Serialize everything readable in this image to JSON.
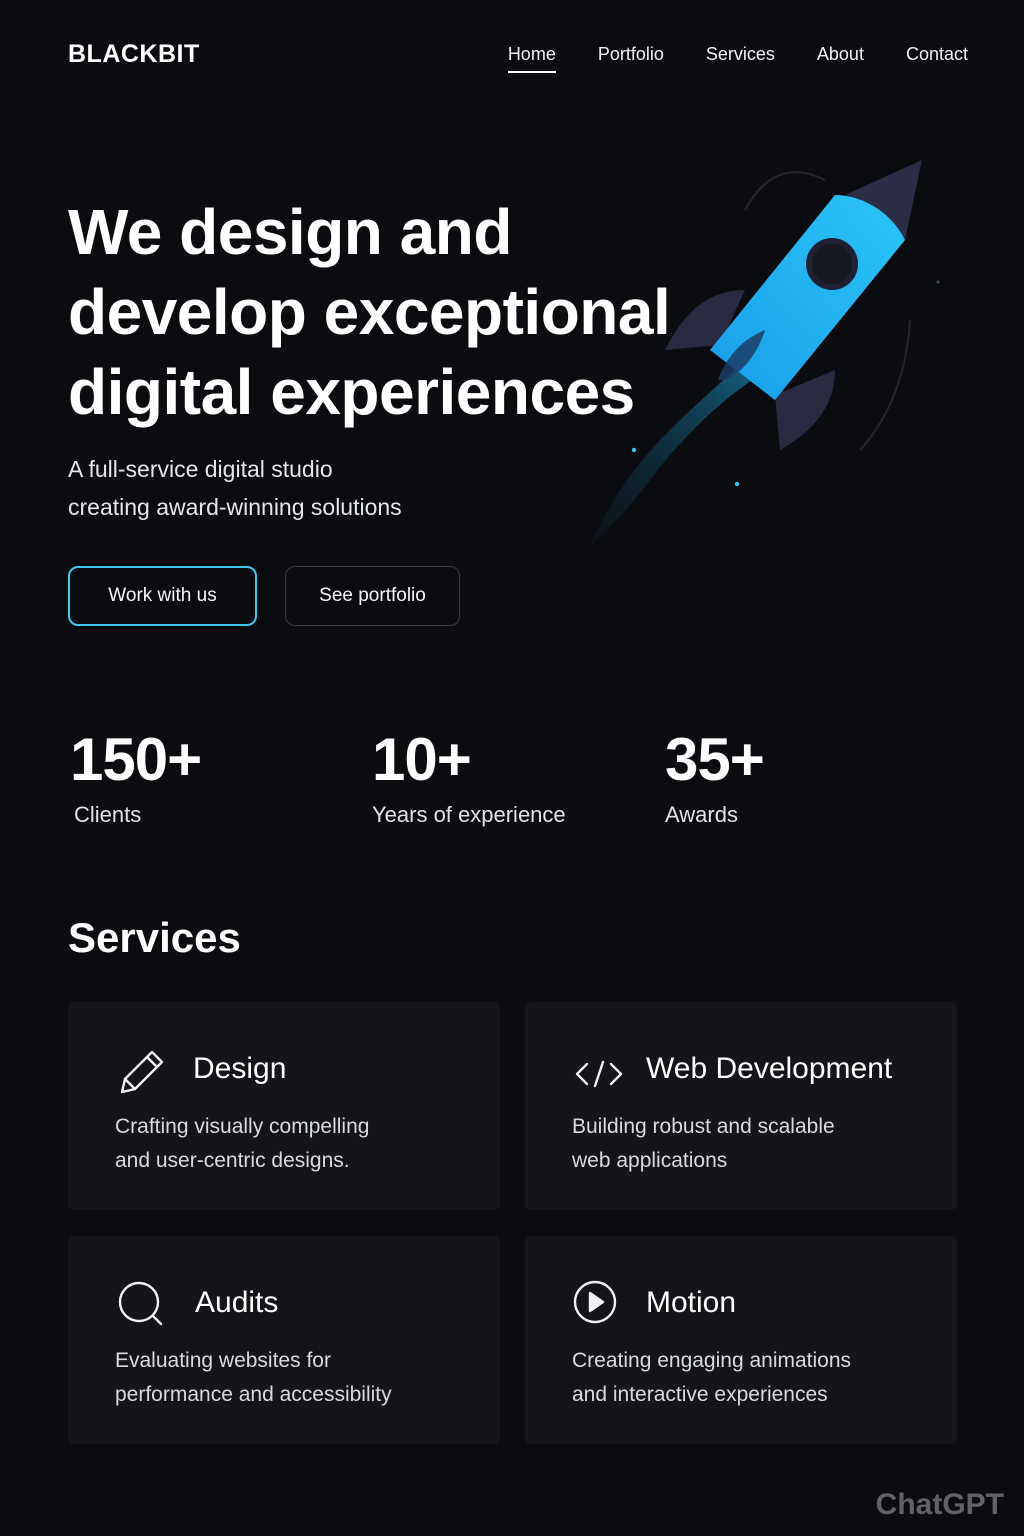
{
  "brand": {
    "logo": "BLACKBIT"
  },
  "nav": {
    "items": [
      {
        "label": "Home",
        "active": true
      },
      {
        "label": "Portfolio",
        "active": false
      },
      {
        "label": "Services",
        "active": false
      },
      {
        "label": "About",
        "active": false
      },
      {
        "label": "Contact",
        "active": false
      }
    ]
  },
  "hero": {
    "title_lines": [
      "We design and",
      "develop exceptional",
      "digital experiences"
    ],
    "subtitle_lines": [
      "A full-service digital studio",
      "creating award-winning solutions"
    ],
    "primary_button": "Work with us",
    "secondary_button": "See portfolio",
    "illustration": "rocket-icon"
  },
  "stats": [
    {
      "value": "150+",
      "label": "Clients"
    },
    {
      "value": "10+",
      "label": "Years of experience"
    },
    {
      "value": "35+",
      "label": "Awards"
    }
  ],
  "services": {
    "title": "Services",
    "items": [
      {
        "icon": "pencil-icon",
        "title": "Design",
        "desc_lines": [
          "Crafting visually compelling",
          "and user-centric designs."
        ]
      },
      {
        "icon": "code-icon",
        "title": "Web Development",
        "desc_lines": [
          "Building robust and scalable",
          "web applications"
        ]
      },
      {
        "icon": "search-icon",
        "title": "Audits",
        "desc_lines": [
          "Evaluating websites for",
          "performance and accessibility"
        ]
      },
      {
        "icon": "play-icon",
        "title": "Motion",
        "desc_lines": [
          "Creating engaging animations",
          "and interactive experiences"
        ]
      }
    ]
  },
  "watermark": "ChatGPT",
  "colors": {
    "background": "#0b0c0f",
    "card": "#141518",
    "accent": "#3ec8ee",
    "rocket_body": "#1fb3f5",
    "rocket_dark": "#2a2d45"
  }
}
